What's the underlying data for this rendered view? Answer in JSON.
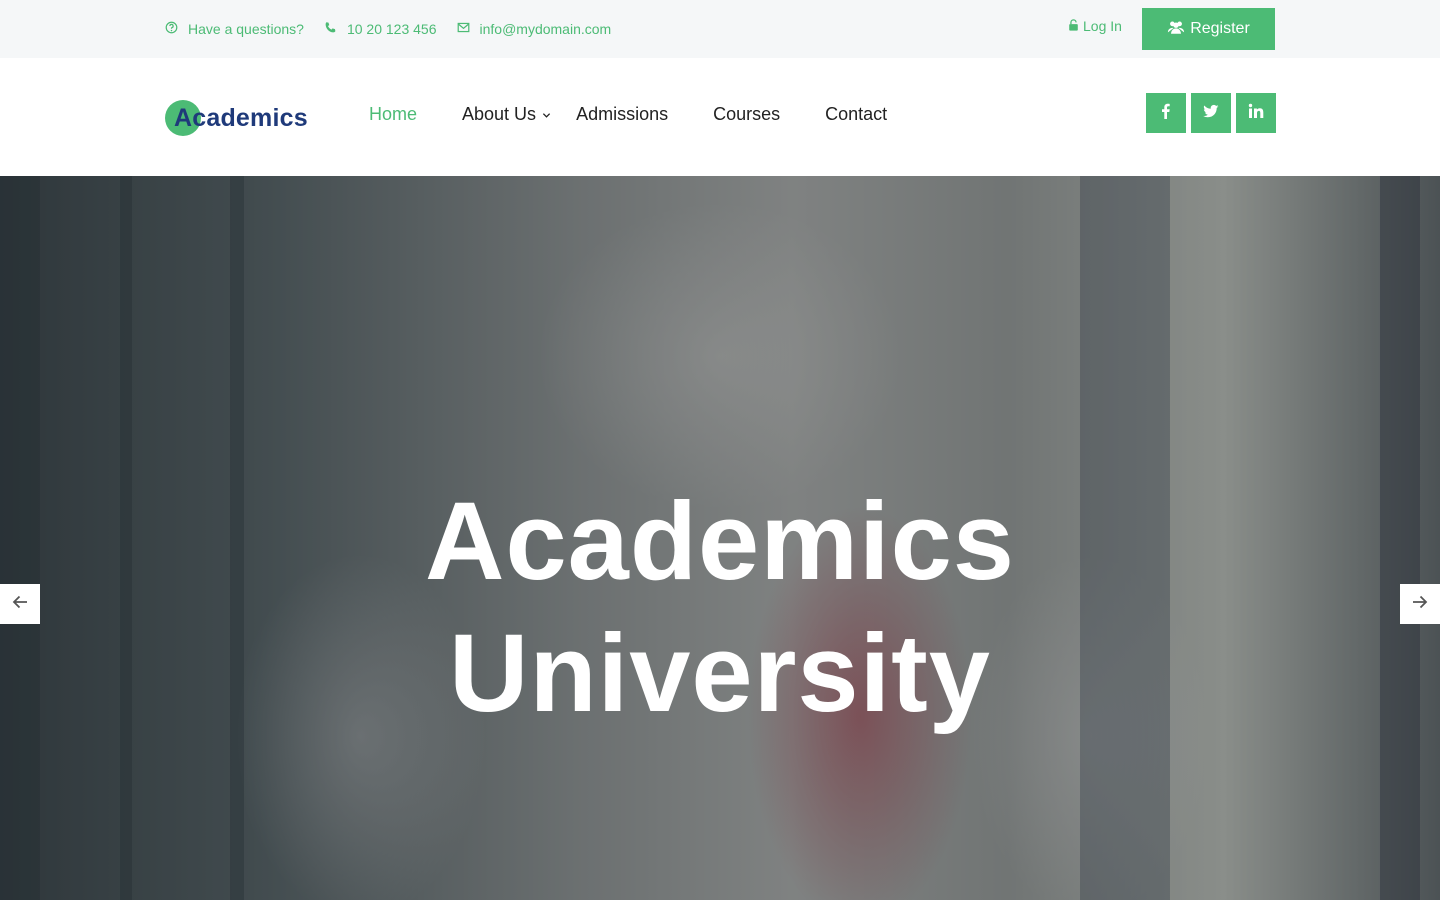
{
  "topbar": {
    "question_text": "Have a questions?",
    "phone": "10 20 123 456",
    "email": "info@mydomain.com",
    "login_label": "Log In",
    "register_label": "Register",
    "icons": [
      "question-circle-icon",
      "phone-icon",
      "envelope-icon",
      "lock-icon",
      "users-icon"
    ]
  },
  "header": {
    "logo_text": "Academics",
    "nav": {
      "home": "Home",
      "about": "About Us",
      "admissions": "Admissions",
      "courses": "Courses",
      "contact": "Contact"
    },
    "social_icons": [
      "facebook-icon",
      "twitter-icon",
      "linkedin-icon"
    ]
  },
  "hero": {
    "title_line1": "Academics",
    "title_line2": "University"
  },
  "colors": {
    "accent": "#4cbb75",
    "brand_dark": "#1f3a7a",
    "topbar_bg": "#f5f7f8"
  }
}
